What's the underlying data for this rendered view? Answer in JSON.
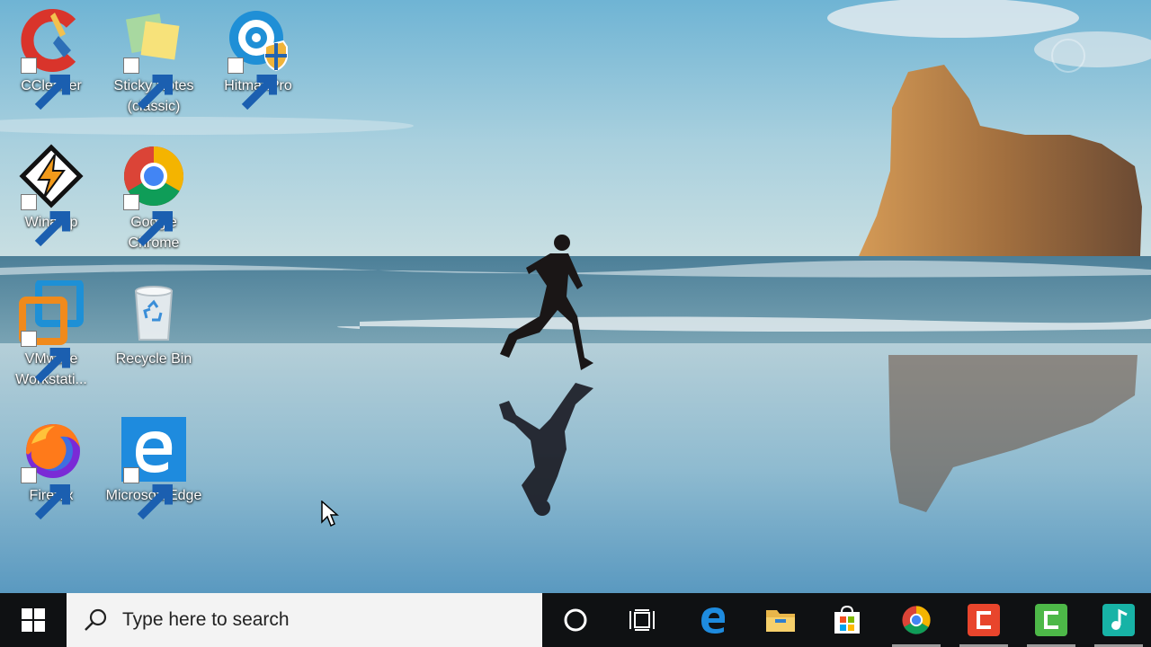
{
  "desktop": {
    "icons": [
      {
        "label": "CCleaner",
        "icon": "ccleaner-icon"
      },
      {
        "label": "Sticky Notes (classic)",
        "icon": "sticky-notes-icon"
      },
      {
        "label": "HitmanPro",
        "icon": "hitmanpro-icon"
      },
      {
        "label": "Winamp",
        "icon": "winamp-icon"
      },
      {
        "label": "Google Chrome",
        "icon": "chrome-icon"
      },
      {
        "label": "VMware Workstati...",
        "icon": "vmware-icon"
      },
      {
        "label": "Recycle Bin",
        "icon": "recycle-bin-icon"
      },
      {
        "label": "Firefox",
        "icon": "firefox-icon"
      },
      {
        "label": "Microsoft Edge",
        "icon": "edge-icon"
      }
    ]
  },
  "taskbar": {
    "search": {
      "placeholder": "Type here to search"
    },
    "pinned": [
      {
        "name": "cortana",
        "icon": "cortana-icon"
      },
      {
        "name": "task-view",
        "icon": "task-view-icon"
      },
      {
        "name": "edge",
        "icon": "edge-icon"
      },
      {
        "name": "file-explorer",
        "icon": "folder-icon"
      },
      {
        "name": "store",
        "icon": "store-icon"
      },
      {
        "name": "chrome",
        "icon": "chrome-icon"
      },
      {
        "name": "ccleaner",
        "icon": "ccleaner-icon"
      },
      {
        "name": "camtasia",
        "icon": "camtasia-icon"
      },
      {
        "name": "audio-app",
        "icon": "music-app-icon"
      }
    ]
  },
  "colors": {
    "taskbar": "#0f1113",
    "search_box": "#f3f3f3",
    "accent": "#0078d7"
  }
}
